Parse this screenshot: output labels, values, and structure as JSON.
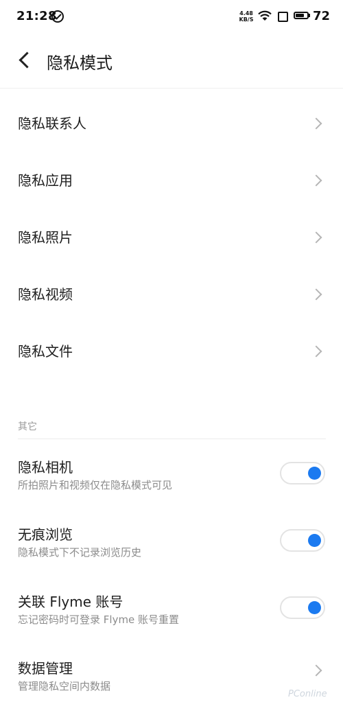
{
  "status_bar": {
    "time": "21:28",
    "net_speed_value": "4.48",
    "net_speed_unit": "KB/S",
    "battery": "72",
    "battery_level_percent": 72,
    "icons": [
      "check-circle-icon",
      "wifi-icon",
      "sim-icon",
      "battery-icon"
    ]
  },
  "nav": {
    "title": "隐私模式",
    "back_icon": "chevron-left-icon"
  },
  "menu": [
    {
      "label": "隐私联系人"
    },
    {
      "label": "隐私应用"
    },
    {
      "label": "隐私照片"
    },
    {
      "label": "隐私视频"
    },
    {
      "label": "隐私文件"
    }
  ],
  "other_section": {
    "title": "其它",
    "options": [
      {
        "label": "隐私相机",
        "desc": "所拍照片和视频仅在隐私模式可见",
        "toggle_on": true
      },
      {
        "label": "无痕浏览",
        "desc": "隐私模式下不记录浏览历史",
        "toggle_on": true
      },
      {
        "label": "关联 Flyme 账号",
        "desc": "忘记密码时可登录 Flyme 账号重置",
        "toggle_on": true
      },
      {
        "label": "数据管理",
        "desc": "管理隐私空间内数据"
      }
    ]
  },
  "watermark": "PConline",
  "colors": {
    "accent": "#1b7af0",
    "chevron": "#b5b5b5",
    "secondary_text": "#8c8c8c",
    "section_header": "#9a9a9a"
  }
}
